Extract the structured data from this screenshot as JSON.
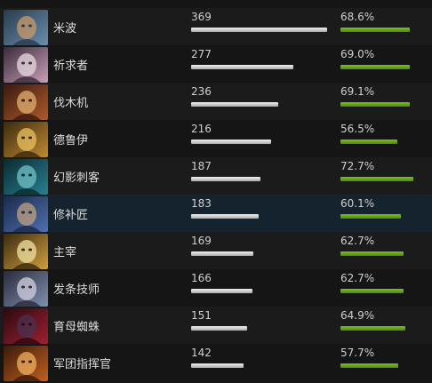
{
  "max_count": 369,
  "rows": [
    {
      "hero": "米波",
      "count": "369",
      "winrate": "68.6%",
      "portrait_icon": "meepo-portrait",
      "colors": [
        "#2a3a4a",
        "#6a8fb0",
        "#c99a6a"
      ]
    },
    {
      "hero": "祈求者",
      "count": "277",
      "winrate": "69.0%",
      "portrait_icon": "invoker-portrait",
      "colors": [
        "#3a2a3a",
        "#c9a0b8",
        "#e8d8e0"
      ]
    },
    {
      "hero": "伐木机",
      "count": "236",
      "winrate": "69.1%",
      "portrait_icon": "timbersaw-portrait",
      "colors": [
        "#3a1a10",
        "#b05a2a",
        "#e0b070"
      ]
    },
    {
      "hero": "德鲁伊",
      "count": "216",
      "winrate": "56.5%",
      "portrait_icon": "lone-druid-portrait",
      "colors": [
        "#3a2a10",
        "#c08a30",
        "#e8c060"
      ]
    },
    {
      "hero": "幻影刺客",
      "count": "187",
      "winrate": "72.7%",
      "portrait_icon": "phantom-assassin-portrait",
      "colors": [
        "#0a2a30",
        "#2a8090",
        "#70c0c8"
      ]
    },
    {
      "hero": "修补匠",
      "count": "183",
      "winrate": "60.1%",
      "portrait_icon": "tinker-portrait",
      "colors": [
        "#1a2a4a",
        "#5070b0",
        "#c0a080"
      ]
    },
    {
      "hero": "主宰",
      "count": "169",
      "winrate": "62.7%",
      "portrait_icon": "juggernaut-portrait",
      "colors": [
        "#3a2a10",
        "#d0a040",
        "#f0e0a0"
      ]
    },
    {
      "hero": "发条技师",
      "count": "166",
      "winrate": "62.7%",
      "portrait_icon": "clockwerk-portrait",
      "colors": [
        "#2a2a3a",
        "#8090b0",
        "#d0d0e0"
      ]
    },
    {
      "hero": "育母蜘蛛",
      "count": "151",
      "winrate": "64.9%",
      "portrait_icon": "broodmother-portrait",
      "colors": [
        "#2a0a10",
        "#a02030",
        "#4a3050"
      ]
    },
    {
      "hero": "军团指挥官",
      "count": "142",
      "winrate": "57.7%",
      "portrait_icon": "legion-commander-portrait",
      "colors": [
        "#3a1a0a",
        "#c06020",
        "#f0b060"
      ]
    }
  ]
}
